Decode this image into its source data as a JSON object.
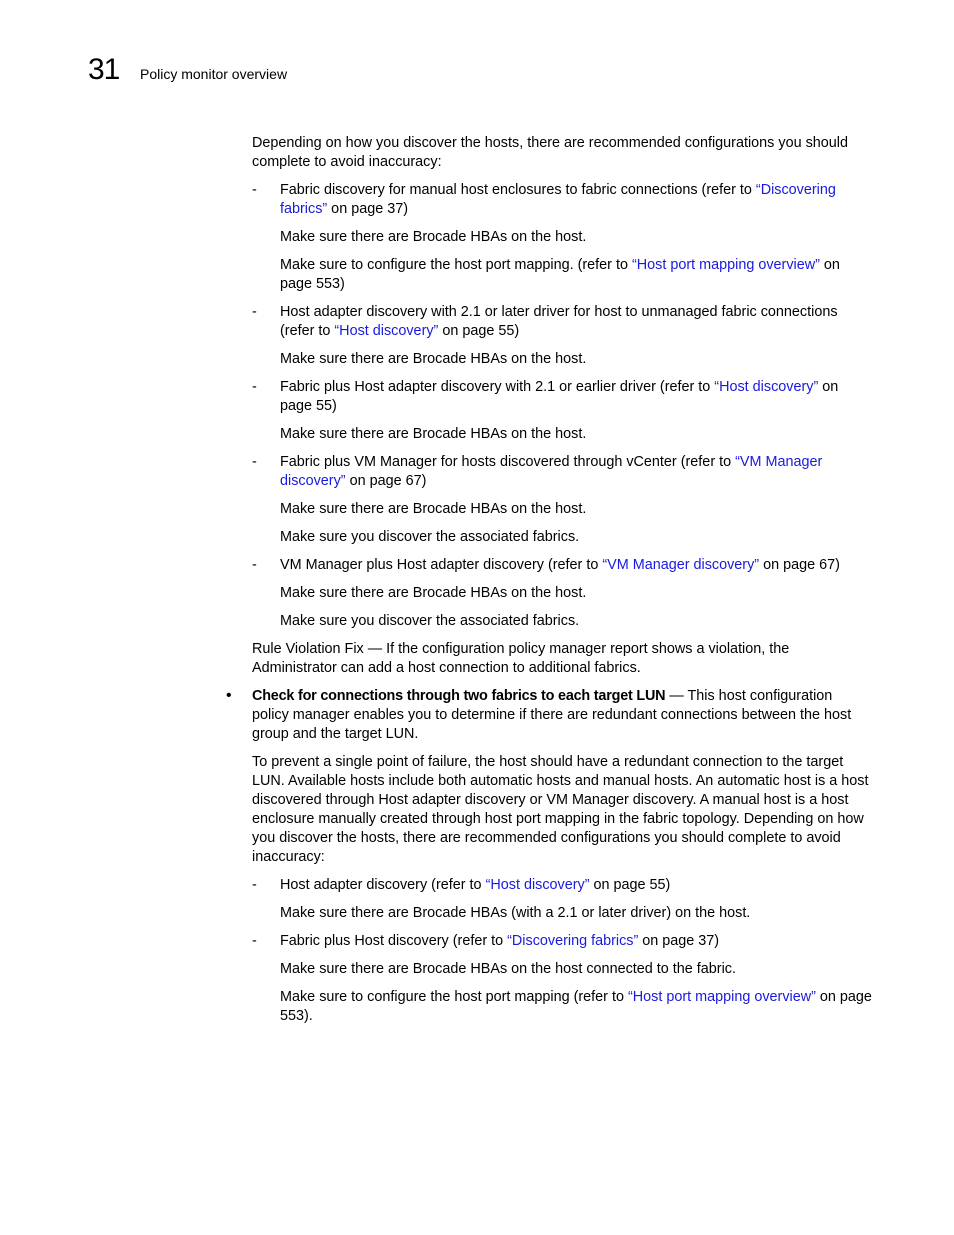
{
  "header": {
    "chapter_number": "31",
    "chapter_title": "Policy monitor overview"
  },
  "section1": {
    "intro": "Depending on how you discover the hosts, there are recommended configurations you should complete to avoid inaccuracy:",
    "items": [
      {
        "dash": "-",
        "text_before": "Fabric discovery for manual host enclosures to fabric connections (refer to ",
        "link": "“Discovering fabrics”",
        "text_after": " on page 37)",
        "notes": [
          {
            "text_before": "Make sure there are Brocade HBAs on the host.",
            "link": "",
            "text_after": ""
          },
          {
            "text_before": "Make sure to configure the host port mapping. (refer to ",
            "link": "“Host port mapping overview”",
            "text_after": " on page 553)"
          }
        ]
      },
      {
        "dash": "-",
        "text_before": "Host adapter discovery with 2.1 or later driver for host to unmanaged fabric connections (refer to ",
        "link": "“Host discovery”",
        "text_after": " on page 55)",
        "notes": [
          {
            "text_before": "Make sure there are Brocade HBAs on the host.",
            "link": "",
            "text_after": ""
          }
        ]
      },
      {
        "dash": "-",
        "text_before": "Fabric plus Host adapter discovery with 2.1 or earlier driver (refer to ",
        "link": "“Host discovery”",
        "text_after": " on page 55)",
        "notes": [
          {
            "text_before": "Make sure there are Brocade HBAs on the host.",
            "link": "",
            "text_after": ""
          }
        ]
      },
      {
        "dash": "-",
        "text_before": "Fabric plus VM Manager for hosts discovered through vCenter (refer to ",
        "link": "“VM Manager discovery”",
        "text_after": " on page 67)",
        "notes": [
          {
            "text_before": "Make sure there are Brocade HBAs on the host.",
            "link": "",
            "text_after": ""
          },
          {
            "text_before": "Make sure you discover the associated fabrics.",
            "link": "",
            "text_after": ""
          }
        ]
      },
      {
        "dash": "-",
        "text_before": "VM Manager plus Host adapter discovery (refer to ",
        "link": "“VM Manager discovery”",
        "text_after": " on page 67)",
        "notes": [
          {
            "text_before": "Make sure there are Brocade HBAs on the host.",
            "link": "",
            "text_after": ""
          },
          {
            "text_before": "Make sure you discover the associated fabrics.",
            "link": "",
            "text_after": ""
          }
        ]
      }
    ],
    "rule_fix": "Rule Violation Fix — If the configuration policy manager report shows a violation, the Administrator can add a host connection to additional fabrics."
  },
  "section2": {
    "bullet": "•",
    "bold_title": "Check for connections through two fabrics to each target LUN",
    "title_rest": " — This host configuration policy manager enables you to determine if there are redundant connections between the host group and the target LUN.",
    "para": "To prevent a single point of failure, the host should have a redundant connection to the target LUN. Available hosts include both automatic hosts and manual hosts. An automatic host is a host discovered through Host adapter discovery or VM Manager discovery. A manual host is a host enclosure manually created through host port mapping in the fabric topology. Depending on how you discover the hosts, there are recommended configurations you should complete to avoid inaccuracy:",
    "items": [
      {
        "dash": "-",
        "text_before": "Host adapter discovery (refer to ",
        "link": "“Host discovery”",
        "text_after": " on page 55)",
        "notes": [
          {
            "text_before": "Make sure there are Brocade HBAs (with a 2.1 or later driver) on the host.",
            "link": "",
            "text_after": ""
          }
        ]
      },
      {
        "dash": "-",
        "text_before": "Fabric plus Host discovery (refer to ",
        "link": "“Discovering fabrics”",
        "text_after": " on page 37)",
        "notes": [
          {
            "text_before": "Make sure there are Brocade HBAs on the host connected to the fabric.",
            "link": "",
            "text_after": ""
          },
          {
            "text_before": "Make sure to configure the host port mapping (refer to ",
            "link": "“Host port mapping overview”",
            "text_after": " on page 553)."
          }
        ]
      }
    ]
  },
  "colors": {
    "link": "#1a1adf",
    "text": "#000000"
  }
}
